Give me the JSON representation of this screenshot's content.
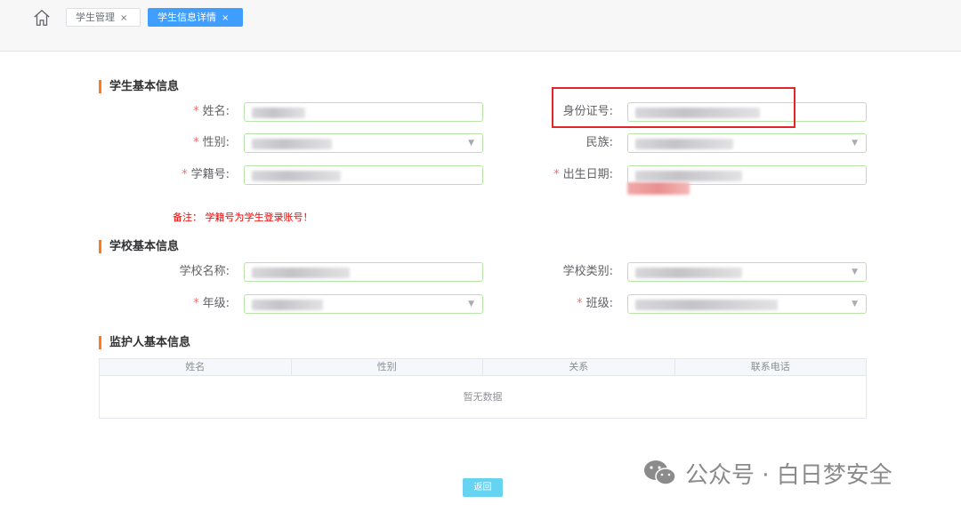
{
  "tabs": [
    {
      "label": "学生管理",
      "close": "×"
    },
    {
      "label": "学生信息详情",
      "close": "×"
    }
  ],
  "sections": {
    "student": "学生基本信息",
    "school": "学校基本信息",
    "guardian": "监护人基本信息"
  },
  "required_mark": "*",
  "fields": {
    "name": "姓名:",
    "id_card": "身份证号:",
    "gender": "性别:",
    "ethnicity": "民族:",
    "student_no": "学籍号:",
    "birthdate": "出生日期:",
    "school_name": "学校名称:",
    "school_type": "学校类别:",
    "grade": "年级:",
    "class": "班级:"
  },
  "note": "备注： 学籍号为学生登录账号！",
  "guardian_table": {
    "columns": [
      "姓名",
      "性别",
      "关系",
      "联系电话"
    ],
    "empty_text": "暂无数据"
  },
  "back_button": "返回",
  "watermark": "公众号 · 白日梦安全",
  "icons": {
    "home": "home-icon",
    "dropdown": "chevron-down-icon",
    "close": "close-icon",
    "wechat": "wechat-icon"
  },
  "colors": {
    "accent": "#409eff",
    "section_bar": "#ff7a1a",
    "required": "#f56c6c",
    "highlight": "#e0262a",
    "back_button": "#66d3f1"
  }
}
